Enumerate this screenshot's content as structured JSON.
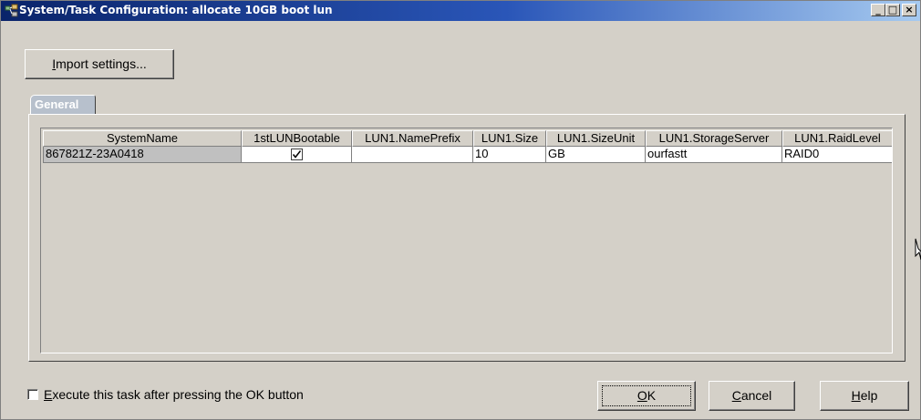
{
  "window": {
    "title": "System/Task Configuration: allocate 10GB boot lun",
    "controls": {
      "minimize": "_",
      "maximize": "□",
      "close": "×"
    }
  },
  "toolbar": {
    "import_label_u": "I",
    "import_label_rest": "mport settings..."
  },
  "tabs": [
    {
      "label": "General",
      "active": true
    }
  ],
  "table": {
    "columns": [
      "SystemName",
      "1stLUNBootable",
      "LUN1.NamePrefix",
      "LUN1.Size",
      "LUN1.SizeUnit",
      "LUN1.StorageServer",
      "LUN1.RaidLevel"
    ],
    "rows": [
      {
        "SystemName": "867821Z-23A0418",
        "1stLUNBootable": true,
        "LUN1.NamePrefix": "",
        "LUN1.Size": "10",
        "LUN1.SizeUnit": "GB",
        "LUN1.StorageServer": "ourfastt",
        "LUN1.RaidLevel": "RAID0"
      }
    ]
  },
  "footer": {
    "execute_checkbox": {
      "checked": false,
      "label_u": "E",
      "label_rest": "xecute this task after pressing the OK button"
    },
    "ok_u": "O",
    "ok_rest": "K",
    "cancel_u": "C",
    "cancel_rest": "ancel",
    "help_u": "H",
    "help_rest": "elp"
  },
  "colors": {
    "title_gradient_start": "#0a246a",
    "title_gradient_end": "#a6caf0",
    "window_bg": "#d4d0c8",
    "tab_bg": "#b7c0cc"
  }
}
